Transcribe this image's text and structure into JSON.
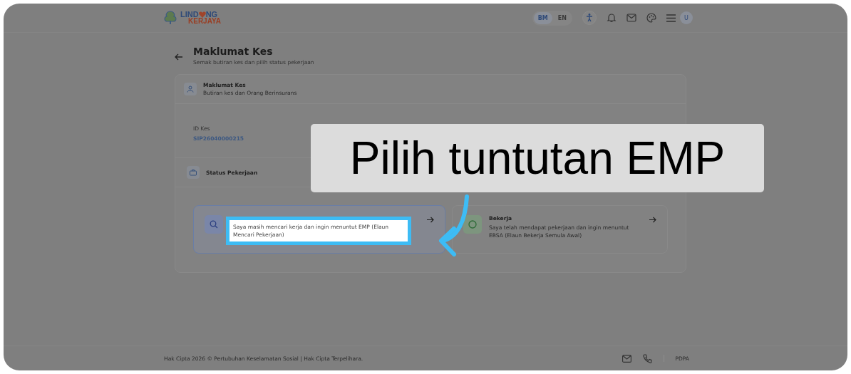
{
  "header": {
    "logo": {
      "line1_start": "LIND",
      "line1_end": "NG",
      "line2": "KERJAYA"
    },
    "languages": [
      {
        "label": "BM",
        "selected": true
      },
      {
        "label": "EN",
        "selected": false
      }
    ],
    "avatar": "U"
  },
  "page": {
    "title": "Maklumat Kes",
    "subtitle": "Semak butiran kes dan pilih status pekerjaan"
  },
  "case_section": {
    "title": "Maklumat Kes",
    "subtitle": "Butiran kes dan Orang Berinsurans",
    "fields": [
      {
        "label": "ID Kes",
        "value": "SIP26040000215"
      }
    ]
  },
  "status_section": {
    "title": "Status Pekerjaan",
    "options": [
      {
        "kind": "search",
        "selected": true,
        "highlighted": true,
        "description": "Saya masih mencari kerja dan ingin menuntut EMP (Elaun Mencari Pekerjaan)"
      },
      {
        "kind": "work",
        "selected": false,
        "highlighted": false,
        "title": "Bekerja",
        "description": "Saya telah mendapat pekerjaan dan ingin menuntut EBSA (Elaun Bekerja Semula Awal)"
      }
    ]
  },
  "callout": "Pilih tuntutan EMP",
  "footer": {
    "copyright": "Hak Cipta 2026 © Pertubuhan Keselamatan Sosial | Hak Cipta Terpelihara.",
    "link": "PDPA"
  }
}
